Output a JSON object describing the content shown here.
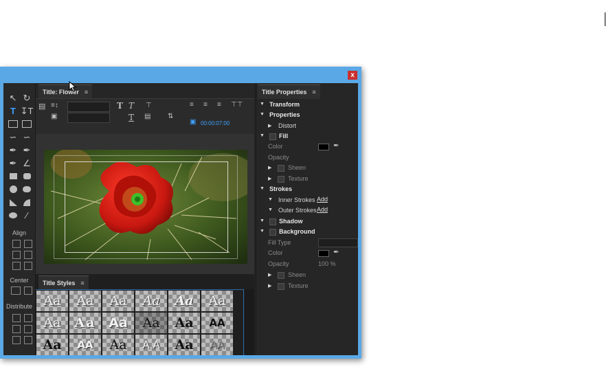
{
  "window": {
    "close_label": "x"
  },
  "tools": {
    "align_label": "Align",
    "center_label": "Center",
    "distribute_label": "Distribute"
  },
  "title_panel": {
    "tab_label": "Title: Flower",
    "menu_glyph": "≡",
    "timecode": "00:00:07:00"
  },
  "styles_panel": {
    "tab_label": "Title Styles",
    "menu_glyph": "≡",
    "samples": [
      "Aa",
      "Aa",
      "Aa",
      "Aa",
      "Aa",
      "Aa",
      "Aa",
      "Aa",
      "Aa",
      "Aa",
      "Aa",
      "AA",
      "Aa",
      "AA",
      "Aa",
      "A A",
      "Aa",
      "AA"
    ]
  },
  "properties_panel": {
    "tab_label": "Title Properties",
    "menu_glyph": "≡",
    "rows": {
      "transform": "Transform",
      "properties": "Properties",
      "distort": "Distort",
      "fill": "Fill",
      "color": "Color",
      "opacity": "Opacity",
      "sheen": "Sheen",
      "texture": "Texture",
      "strokes": "Strokes",
      "inner_strokes": "Inner Strokes",
      "outer_strokes": "Outer Strokes",
      "add": "Add",
      "shadow": "Shadow",
      "background": "Background",
      "fill_type": "Fill Type",
      "bg_color": "Color",
      "bg_opacity": "Opacity",
      "bg_opacity_value": "100 %",
      "bg_sheen": "Sheen",
      "bg_texture": "Texture"
    }
  },
  "colors": {
    "window_frame": "#5aa8e6",
    "accent_blue": "#3fa0ff",
    "panel_bg": "#262626"
  }
}
